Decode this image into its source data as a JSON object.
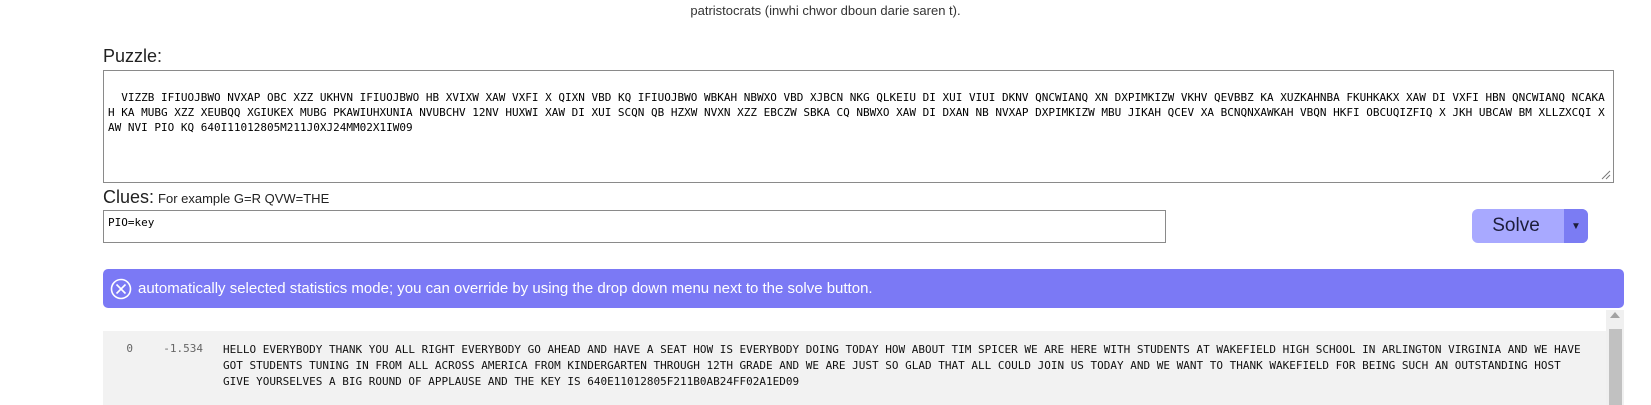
{
  "top_text": "patristocrats (inwhi chwor dboun darie saren t).",
  "puzzle": {
    "label": "Puzzle:",
    "text": "VIZZB IFIUOJBWO NVXAP OBC XZZ UKHVN IFIUOJBWO HB XVIXW XAW VXFI X QIXN VBD KQ IFIUOJBWO WBKAH NBWXO VBD XJBCN NKG QLKEIU DI XUI VIUI DKNV QNCWIANQ XN DXPIMKIZW VKHV QEVBBZ KA XUZKAHNBA FKUHKAKX XAW DI VXFI HBN QNCWIANQ NCAKAH KA MUBG XZZ XEUBQQ XGIUKEX MUBG PKAWIUHXUNIA NVUBCHV 12NV HUXWI XAW DI XUI SCQN QB HZXW NVXN XZZ EBCZW SBKA CQ NBWXO XAW DI DXAN NB NVXAP DXPIMKIZW MBU JIKAH QCEV XA BCNQNXAWKAH VBQN HKFI OBCUQIZFIQ X JKH UBCAW BM XLLZXCQI XAW NVI PIO KQ 640I11012805M211J0XJ24MM02X1IW09"
  },
  "clues": {
    "label": "Clues:",
    "hint": "For example G=R QVW=THE",
    "value": "PIO=key"
  },
  "solve_button": {
    "label": "Solve",
    "dropdown_glyph": "▼"
  },
  "banner": {
    "text": "automatically selected statistics mode; you can override by using the drop down menu next to the solve button."
  },
  "results": [
    {
      "index": "0",
      "score": "-1.534",
      "text": "HELLO EVERYBODY THANK YOU ALL RIGHT EVERYBODY GO AHEAD AND HAVE A SEAT HOW IS EVERYBODY DOING TODAY HOW ABOUT TIM SPICER WE ARE HERE WITH STUDENTS AT WAKEFIELD HIGH SCHOOL IN ARLINGTON VIRGINIA AND WE HAVE GOT STUDENTS TUNING IN FROM ALL ACROSS AMERICA FROM KINDERGARTEN THROUGH 12TH GRADE AND WE ARE JUST SO GLAD THAT ALL COULD JOIN US TODAY AND WE WANT TO THANK WAKEFIELD FOR BEING SUCH AN OUTSTANDING HOST GIVE YOURSELVES A BIG ROUND OF APPLAUSE AND THE KEY IS 640E11012805F211B0AB24FF02A1ED09"
    }
  ],
  "colors": {
    "banner": "#7b79f5",
    "solve_button": "#a8a9ff",
    "solve_dropdown": "#7b7cf3"
  }
}
